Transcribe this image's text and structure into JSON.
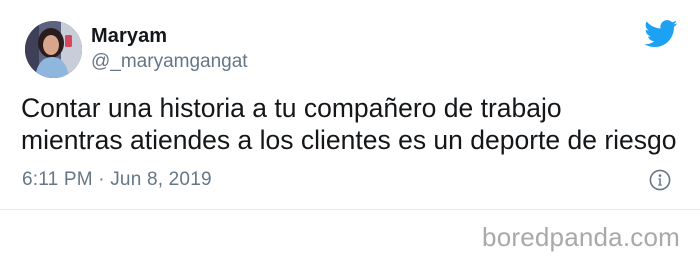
{
  "tweet": {
    "display_name": "Maryam",
    "handle": "@_maryamgangat",
    "text_lines": [
      "Contar una historia a tu compañero de trabajo",
      "mientras atiendes a los clientes es un deporte de riesgo"
    ],
    "timestamp": "6:11 PM · Jun 8, 2019"
  },
  "icons": {
    "brand": "twitter-bird-icon",
    "info": "info-icon"
  },
  "watermark": {
    "text": "boredpanda.com"
  },
  "colors": {
    "twitter_blue": "#1da1f2",
    "text_primary": "#14171a",
    "text_secondary": "#657786",
    "watermark": "#a9a9a9",
    "divider": "#e6ecf0"
  }
}
